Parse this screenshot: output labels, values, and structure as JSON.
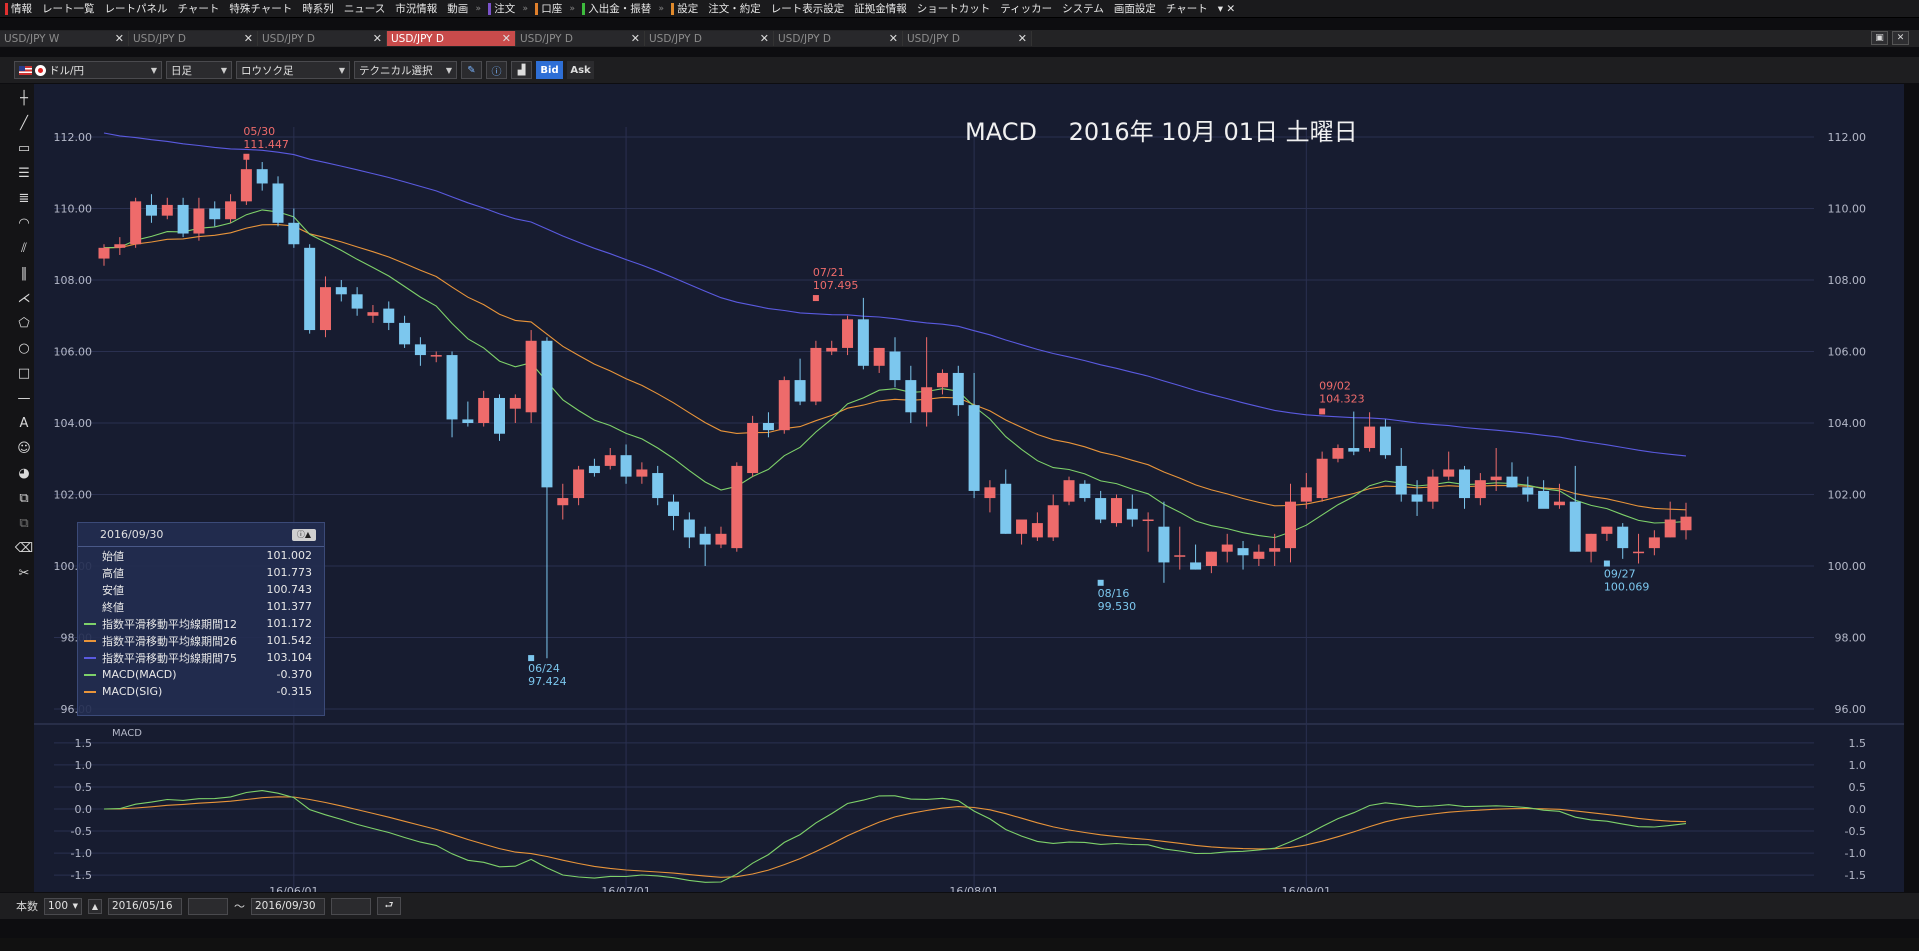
{
  "menubar": {
    "items": [
      {
        "label": "情報",
        "mark": "#e03030"
      },
      {
        "label": "レート一覧"
      },
      {
        "label": "レートパネル"
      },
      {
        "label": "チャート"
      },
      {
        "label": "特殊チャート"
      },
      {
        "label": "時系列"
      },
      {
        "label": "ニュース"
      },
      {
        "label": "市況情報"
      },
      {
        "label": "動画"
      },
      {
        "label": "注文",
        "mark": "#7a52c9",
        "sep": true
      },
      {
        "label": "口座",
        "mark": "#e0802c",
        "sep": true
      },
      {
        "label": "入出金・振替",
        "mark": "#3dbb3d",
        "sep": true
      },
      {
        "label": "設定",
        "mark": "#e08a2c",
        "sep": true
      },
      {
        "label": "注文・約定"
      },
      {
        "label": "レート表示設定"
      },
      {
        "label": "証拠金情報"
      },
      {
        "label": "ショートカット"
      },
      {
        "label": "ティッカー"
      },
      {
        "label": "システム"
      },
      {
        "label": "画面設定"
      },
      {
        "label": "チャート"
      }
    ]
  },
  "tabs": [
    {
      "label": "USD/JPY W",
      "active": false
    },
    {
      "label": "USD/JPY D",
      "active": false
    },
    {
      "label": "USD/JPY D",
      "active": false
    },
    {
      "label": "USD/JPY D",
      "active": true
    },
    {
      "label": "USD/JPY D",
      "active": false
    },
    {
      "label": "USD/JPY D",
      "active": false
    },
    {
      "label": "USD/JPY D",
      "active": false
    },
    {
      "label": "USD/JPY D",
      "active": false
    }
  ],
  "toolbar": {
    "pair": "ドル/円",
    "timeframe": "日足",
    "chart_type": "ロウソク足",
    "technical": "テクニカル選択",
    "bid": "Bid",
    "ask": "Ask"
  },
  "chart_title": "MACD　 2016年 10月 01日 土曜日",
  "info_panel": {
    "date": "2016/09/30",
    "rows": [
      {
        "label": "始値",
        "value": "101.002"
      },
      {
        "label": "高値",
        "value": "101.773"
      },
      {
        "label": "安値",
        "value": "100.743"
      },
      {
        "label": "終値",
        "value": "101.377"
      },
      {
        "label": "指数平滑移動平均線期間12",
        "value": "101.172",
        "color": "#7ed16a"
      },
      {
        "label": "指数平滑移動平均線期間26",
        "value": "101.542",
        "color": "#e8943a"
      },
      {
        "label": "指数平滑移動平均線期間75",
        "value": "103.104",
        "color": "#5a5ae0"
      },
      {
        "label": "MACD(MACD)",
        "value": "-0.370",
        "color": "#7ed16a"
      },
      {
        "label": "MACD(SIG)",
        "value": "-0.315",
        "color": "#e8943a"
      }
    ]
  },
  "bottombar": {
    "count_label": "本数",
    "count_value": "100",
    "from_date": "2016/05/16",
    "tilde": "〜",
    "to_date": "2016/09/30"
  },
  "statusbar": "",
  "colors": {
    "up": "#ee6b6b",
    "down": "#7cc7ee",
    "ema12": "#7ed16a",
    "ema26": "#e8943a",
    "ema75": "#5a5ae0",
    "background": "#171c30"
  },
  "chart_data": [
    {
      "type": "candlestick",
      "title": "MACD　 2016年 10月 01日 土曜日",
      "xlabels": [
        "16/06/01",
        "16/07/01",
        "16/08/01",
        "16/09/01"
      ],
      "xlabel_index": [
        12,
        33,
        55,
        76
      ],
      "ylim": [
        96,
        112
      ],
      "yticks": [
        "112.00",
        "110.00",
        "108.00",
        "106.00",
        "104.00",
        "102.00",
        "100.00",
        "98.00",
        "96.00"
      ],
      "annotations": [
        {
          "date": "05/30",
          "value": "111.447",
          "index": 9,
          "price": 111.447,
          "kind": "high"
        },
        {
          "date": "06/24",
          "value": "97.424",
          "index": 27,
          "price": 97.424,
          "kind": "low"
        },
        {
          "date": "07/21",
          "value": "107.495",
          "index": 45,
          "price": 107.495,
          "kind": "high"
        },
        {
          "date": "08/16",
          "value": "99.530",
          "index": 63,
          "price": 99.53,
          "kind": "low"
        },
        {
          "date": "09/02",
          "value": "104.323",
          "index": 77,
          "price": 104.323,
          "kind": "high"
        },
        {
          "date": "09/27",
          "value": "100.069",
          "index": 95,
          "price": 100.069,
          "kind": "low"
        }
      ],
      "ohlc": [
        [
          108.6,
          109.0,
          108.4,
          108.9
        ],
        [
          108.9,
          109.2,
          108.7,
          109.0
        ],
        [
          109.0,
          110.3,
          108.9,
          110.2
        ],
        [
          110.1,
          110.4,
          109.6,
          109.8
        ],
        [
          109.8,
          110.3,
          109.7,
          110.1
        ],
        [
          110.1,
          110.3,
          109.2,
          109.3
        ],
        [
          109.3,
          110.3,
          109.1,
          110.0
        ],
        [
          110.0,
          110.2,
          109.5,
          109.7
        ],
        [
          109.7,
          110.4,
          109.6,
          110.2
        ],
        [
          110.2,
          111.45,
          110.1,
          111.1
        ],
        [
          111.1,
          111.3,
          110.5,
          110.7
        ],
        [
          110.7,
          110.9,
          109.5,
          109.6
        ],
        [
          109.6,
          110.0,
          108.9,
          109.0
        ],
        [
          108.9,
          109.0,
          106.5,
          106.6
        ],
        [
          106.6,
          108.1,
          106.4,
          107.8
        ],
        [
          107.8,
          108.0,
          107.4,
          107.6
        ],
        [
          107.6,
          107.8,
          107.0,
          107.2
        ],
        [
          107.0,
          107.3,
          106.8,
          107.1
        ],
        [
          107.2,
          107.4,
          106.6,
          106.8
        ],
        [
          106.8,
          107.0,
          106.1,
          106.2
        ],
        [
          106.2,
          106.4,
          105.6,
          105.9
        ],
        [
          105.9,
          106.0,
          105.7,
          105.9
        ],
        [
          105.9,
          106.0,
          103.6,
          104.1
        ],
        [
          104.1,
          104.6,
          103.9,
          104.0
        ],
        [
          104.0,
          104.9,
          103.9,
          104.7
        ],
        [
          104.7,
          104.8,
          103.5,
          103.7
        ],
        [
          104.4,
          104.8,
          104.0,
          104.7
        ],
        [
          104.3,
          106.6,
          104.0,
          106.3
        ],
        [
          106.3,
          106.4,
          97.42,
          102.2
        ],
        [
          101.7,
          102.3,
          101.3,
          101.9
        ],
        [
          101.9,
          102.8,
          101.7,
          102.7
        ],
        [
          102.8,
          103.0,
          102.5,
          102.6
        ],
        [
          102.8,
          103.3,
          102.7,
          103.1
        ],
        [
          103.1,
          103.4,
          102.3,
          102.5
        ],
        [
          102.5,
          102.9,
          102.3,
          102.7
        ],
        [
          102.6,
          102.8,
          101.7,
          101.9
        ],
        [
          101.8,
          102.0,
          101.0,
          101.4
        ],
        [
          101.3,
          101.5,
          100.5,
          100.8
        ],
        [
          100.9,
          101.1,
          100.0,
          100.6
        ],
        [
          100.6,
          101.1,
          100.5,
          100.9
        ],
        [
          100.5,
          102.9,
          100.4,
          102.8
        ],
        [
          102.6,
          104.2,
          102.5,
          104.0
        ],
        [
          104.0,
          104.3,
          103.6,
          103.8
        ],
        [
          103.8,
          105.3,
          103.7,
          105.2
        ],
        [
          105.2,
          105.8,
          104.5,
          104.6
        ],
        [
          104.6,
          106.3,
          104.5,
          106.1
        ],
        [
          106.0,
          106.3,
          105.9,
          106.1
        ],
        [
          106.1,
          107.0,
          105.9,
          106.9
        ],
        [
          106.9,
          107.5,
          105.5,
          105.6
        ],
        [
          105.6,
          106.1,
          105.4,
          106.1
        ],
        [
          106.0,
          106.4,
          105.0,
          105.2
        ],
        [
          105.2,
          105.6,
          104.0,
          104.3
        ],
        [
          104.3,
          106.4,
          103.9,
          105.0
        ],
        [
          105.0,
          105.5,
          104.8,
          105.4
        ],
        [
          105.4,
          105.6,
          104.2,
          104.5
        ],
        [
          104.5,
          105.4,
          101.9,
          102.1
        ],
        [
          101.9,
          102.4,
          101.5,
          102.2
        ],
        [
          102.3,
          102.7,
          100.9,
          100.9
        ],
        [
          100.9,
          101.2,
          100.6,
          101.3
        ],
        [
          100.8,
          101.5,
          100.7,
          101.2
        ],
        [
          100.8,
          102.0,
          100.7,
          101.7
        ],
        [
          101.8,
          102.5,
          101.7,
          102.4
        ],
        [
          102.3,
          102.4,
          101.8,
          101.9
        ],
        [
          101.9,
          102.1,
          101.2,
          101.3
        ],
        [
          101.2,
          102.0,
          101.1,
          101.9
        ],
        [
          101.6,
          102.0,
          101.1,
          101.3
        ],
        [
          101.3,
          101.5,
          100.4,
          101.3
        ],
        [
          101.1,
          101.8,
          99.53,
          100.1
        ],
        [
          100.3,
          101.1,
          99.9,
          100.3
        ],
        [
          100.1,
          100.6,
          99.9,
          99.9
        ],
        [
          100.0,
          100.4,
          99.8,
          100.4
        ],
        [
          100.4,
          100.9,
          100.1,
          100.6
        ],
        [
          100.5,
          100.7,
          99.9,
          100.3
        ],
        [
          100.2,
          100.6,
          100.0,
          100.4
        ],
        [
          100.4,
          100.9,
          100.0,
          100.5
        ],
        [
          100.5,
          102.3,
          100.1,
          101.8
        ],
        [
          101.8,
          102.6,
          101.6,
          102.2
        ],
        [
          101.9,
          103.2,
          101.8,
          103.0
        ],
        [
          103.0,
          103.4,
          102.9,
          103.3
        ],
        [
          103.3,
          104.32,
          103.1,
          103.2
        ],
        [
          103.3,
          104.3,
          103.2,
          103.9
        ],
        [
          103.9,
          104.1,
          103.0,
          103.1
        ],
        [
          102.8,
          103.3,
          101.8,
          102.0
        ],
        [
          102.0,
          102.4,
          101.4,
          101.8
        ],
        [
          101.8,
          102.7,
          101.6,
          102.5
        ],
        [
          102.5,
          103.2,
          102.4,
          102.7
        ],
        [
          102.7,
          102.8,
          101.6,
          101.9
        ],
        [
          101.9,
          102.6,
          101.7,
          102.4
        ],
        [
          102.4,
          103.3,
          102.1,
          102.5
        ],
        [
          102.5,
          102.9,
          102.2,
          102.2
        ],
        [
          102.2,
          102.5,
          101.8,
          102.0
        ],
        [
          102.1,
          102.4,
          101.8,
          101.6
        ],
        [
          101.7,
          102.3,
          101.6,
          101.8
        ],
        [
          101.8,
          102.8,
          100.4,
          100.4
        ],
        [
          100.4,
          100.9,
          100.1,
          100.9
        ],
        [
          100.9,
          101.1,
          100.7,
          101.1
        ],
        [
          101.1,
          101.2,
          100.2,
          100.5
        ],
        [
          100.4,
          100.9,
          100.07,
          100.4
        ],
        [
          100.5,
          101.0,
          100.3,
          100.8
        ],
        [
          100.8,
          101.8,
          100.8,
          101.3
        ],
        [
          101.0,
          101.77,
          100.74,
          101.38
        ]
      ],
      "ema_series": [
        {
          "name": "指数平滑移動平均線期間12",
          "color": "#7ed16a",
          "period": 12
        },
        {
          "name": "指数平滑移動平均線期間26",
          "color": "#e8943a",
          "period": 26
        },
        {
          "name": "指数平滑移動平均線期間75",
          "color": "#5a5ae0",
          "period": 75
        }
      ]
    },
    {
      "type": "line",
      "title": "MACD",
      "ylim": [
        -1.7,
        1.7
      ],
      "yticks": [
        "1.5",
        "1.0",
        "0.5",
        "0.0",
        "-0.5",
        "-1.0",
        "-1.5"
      ],
      "series": [
        {
          "name": "MACD(MACD)",
          "color": "#7ed16a"
        },
        {
          "name": "MACD(SIG)",
          "color": "#e8943a"
        }
      ]
    }
  ]
}
